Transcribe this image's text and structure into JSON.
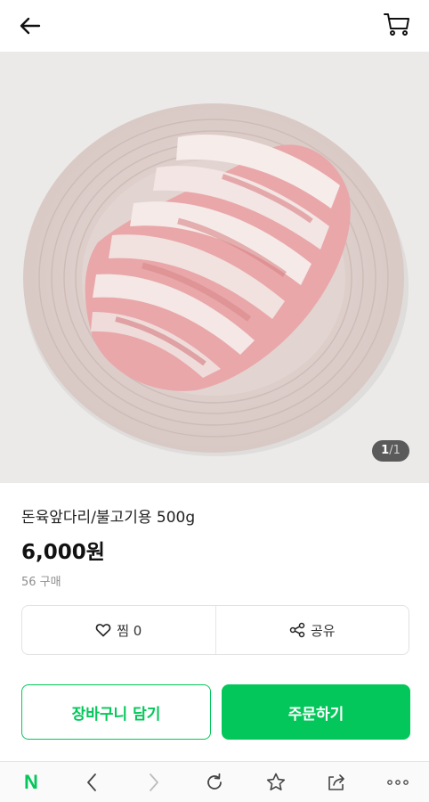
{
  "header": {
    "back_icon": "arrow-left-icon",
    "cart_icon": "cart-icon"
  },
  "gallery": {
    "current": "1",
    "separator": "/",
    "total": "1"
  },
  "product": {
    "title": "돈육앞다리/불고기용 500g",
    "price": "6,000원",
    "purchase_count": "56 구매"
  },
  "actions": {
    "wish_label": "찜 0",
    "share_label": "공유"
  },
  "buttons": {
    "add_to_cart": "장바구니 담기",
    "order": "주문하기"
  },
  "browser_bar": {
    "logo": "N"
  },
  "colors": {
    "accent": "#03c75a",
    "counter_bg": "#5a5a5a"
  }
}
